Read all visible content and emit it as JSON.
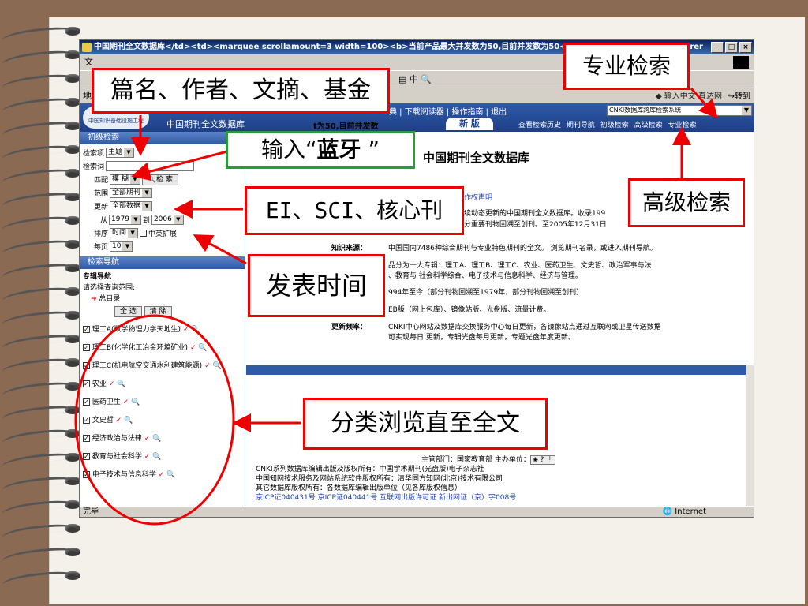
{
  "window": {
    "title": "中国期刊全文数据库</td><td><marquee scrollamount=3 width=100><b>当前产品最大并发数为50,目前并发数为50</b><",
    "title_suffix": "plorer",
    "btn_min": "_",
    "btn_max": "□",
    "btn_close": "×"
  },
  "menu": {
    "first": "文"
  },
  "toolbar": {
    "icons": "▤ 中 🔍"
  },
  "address": {
    "label": "地",
    "right_text": "◆ 输入中文 直达网",
    "goto": "转到"
  },
  "header": {
    "logo_url": "www.cnki.net",
    "logo_sub": "中国知识基础设施工程",
    "title": "中国期刊全文数据库",
    "marquee": "t为50,目前并发数",
    "top_links": "典 | 下载阅读器 | 操作指南 | 退出",
    "system_select": "CNKI数据库跨库检索系统",
    "new_version": "新 版",
    "nav_links": "查看检索历史  期刊导航  初级检索  高级检索  专业检索"
  },
  "search": {
    "panel_title": "初级检索",
    "field_label": "检索项",
    "field_value": "主题",
    "term_label": "检索词",
    "match_label": "匹配",
    "match_value": "模 糊",
    "search_button": "检 索",
    "range_label": "范围",
    "range_value": "全部期刊",
    "update_label": "更新",
    "update_value": "全部数据",
    "from_label": "从",
    "year_from": "1979",
    "to_label": "到",
    "year_to": "2006",
    "sort_label": "排序",
    "sort_value": "时间",
    "extend_label": "中英扩展",
    "page_label": "每页",
    "page_value": "10"
  },
  "nav": {
    "panel_title": "检索导航",
    "sub_title": "专辑导航",
    "hint": "请选择查询范围:",
    "root": "总目录",
    "select_all": "全 选",
    "clear": "清 除",
    "categories": [
      "理工A(数学物理力学天地生)",
      "理工B(化学化工冶金环境矿业)",
      "理工C(机电航空交通水利建筑能源)",
      "农业",
      "医药卫生",
      "文史哲",
      "经济政治与法律",
      "教育与社会科学",
      "电子技术与信息科学"
    ]
  },
  "main": {
    "title": "中国期刊全文数据库",
    "notice_link": "作权声明",
    "intro1": "续动态更新的中国期刊全文数据库。收录199",
    "intro2": "分重要刊物回溯至创刊。至2005年12月31日",
    "k1_label": "知识来源：",
    "k1_value": "中国国内7486种综合期刊与专业特色期刊的全文。 浏览期刊名录，或进入期刊导航。",
    "k2_value1": "品分为十大专辑：理工A、理工B、理工C、农业、医药卫生、文史哲、政治军事与法",
    "k2_value2": "、教育与 社会科学综合、电子技术与信息科学、经济与管理。",
    "k3_value": "994年至今（部分刊物回溯至1979年，部分刊物回溯至创刊）",
    "k4_value": "EB版（网上包库）、镜像站版、光盘版、流量计费。",
    "k5_label": "更新频率：",
    "k5_value1": "CNKI中心网站及数据库交换服务中心每日更新，各镜像站点通过互联网或卫星传送数据",
    "k5_value2": "可实现每日 更新，专辑光盘每月更新，专题光盘年度更新。",
    "footer_center": "主管部门：国家教育部    主办单位：",
    "footer1": "CNKI系列数据库编辑出版及版权所有：中国学术期刊(光盘版)电子杂志社",
    "footer2": "中国知网技术服务及网站系统软件版权所有：清华同方知网(北京)技术有限公司",
    "footer3": "其它数据库版权所有：各数据库编辑出版单位（见各库版权信息）",
    "footer4": "京ICP证040431号  京ICP证040441号  互联网出版许可证  新出网证（京）字008号"
  },
  "status": {
    "left": "完毕",
    "zone": "Internet"
  },
  "callouts": {
    "fields": "篇名、作者、文摘、基金",
    "input_prefix": "输入“",
    "input_keyword": "蓝牙",
    "input_suffix": " ”",
    "professional": "专业检索",
    "advanced": "高级检索",
    "range": "EI、SCI、核心刊",
    "time": "发表时间",
    "browse": "分类浏览直至全文"
  },
  "colors": {
    "callout_border": "#e00000",
    "callout_green": "#2a9a3a",
    "header_blue": "#1e3f86"
  }
}
